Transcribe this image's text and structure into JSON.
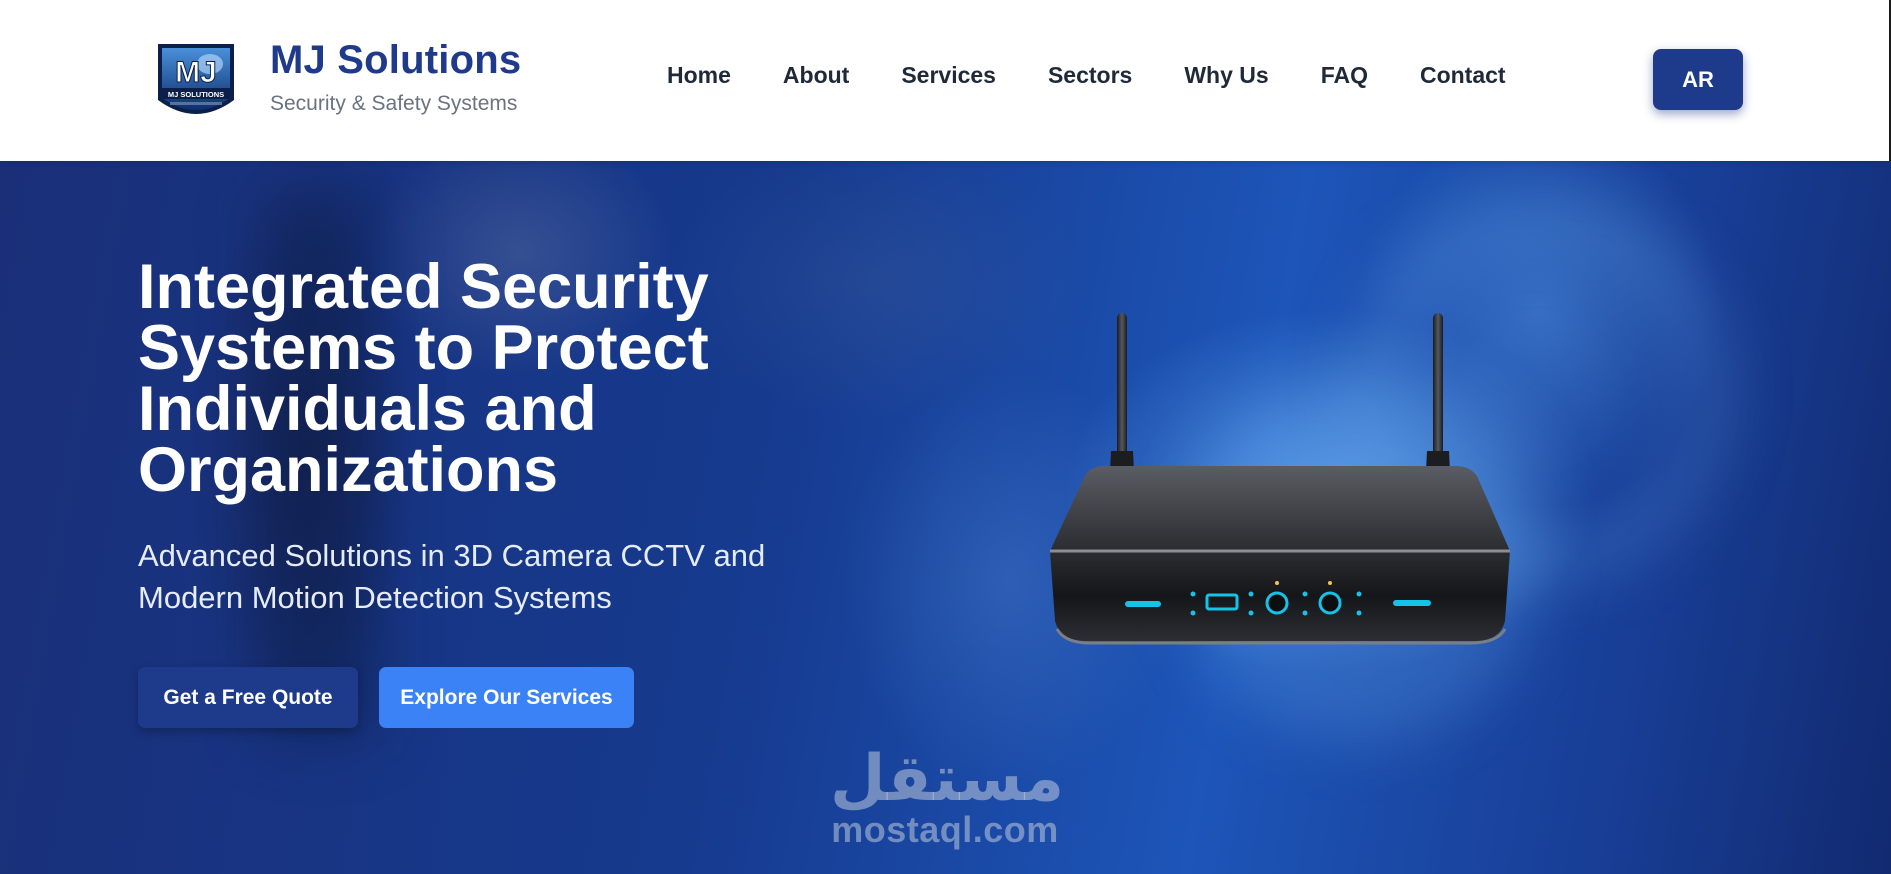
{
  "brand": {
    "name": "MJ Solutions",
    "tagline": "Security & Safety Systems",
    "logo_text": "MJ SOLUTIONS"
  },
  "nav": {
    "items": [
      {
        "label": "Home"
      },
      {
        "label": "About"
      },
      {
        "label": "Services"
      },
      {
        "label": "Sectors"
      },
      {
        "label": "Why Us"
      },
      {
        "label": "FAQ"
      },
      {
        "label": "Contact"
      }
    ],
    "lang_button": "AR"
  },
  "hero": {
    "title": "Integrated Security Systems to Protect Individuals and Organizations",
    "subtitle": "Advanced Solutions in 3D Camera CCTV and Modern Motion Detection Systems",
    "primary_button": "Get a Free Quote",
    "secondary_button": "Explore Our Services",
    "image": "router-device"
  },
  "watermark": {
    "arabic": "مستقل",
    "latin": "mostaql.com"
  },
  "colors": {
    "brand_primary": "#1e3a8a",
    "accent_blue": "#3b82f6",
    "header_bg": "#ffffff",
    "nav_text": "#1f2937"
  }
}
